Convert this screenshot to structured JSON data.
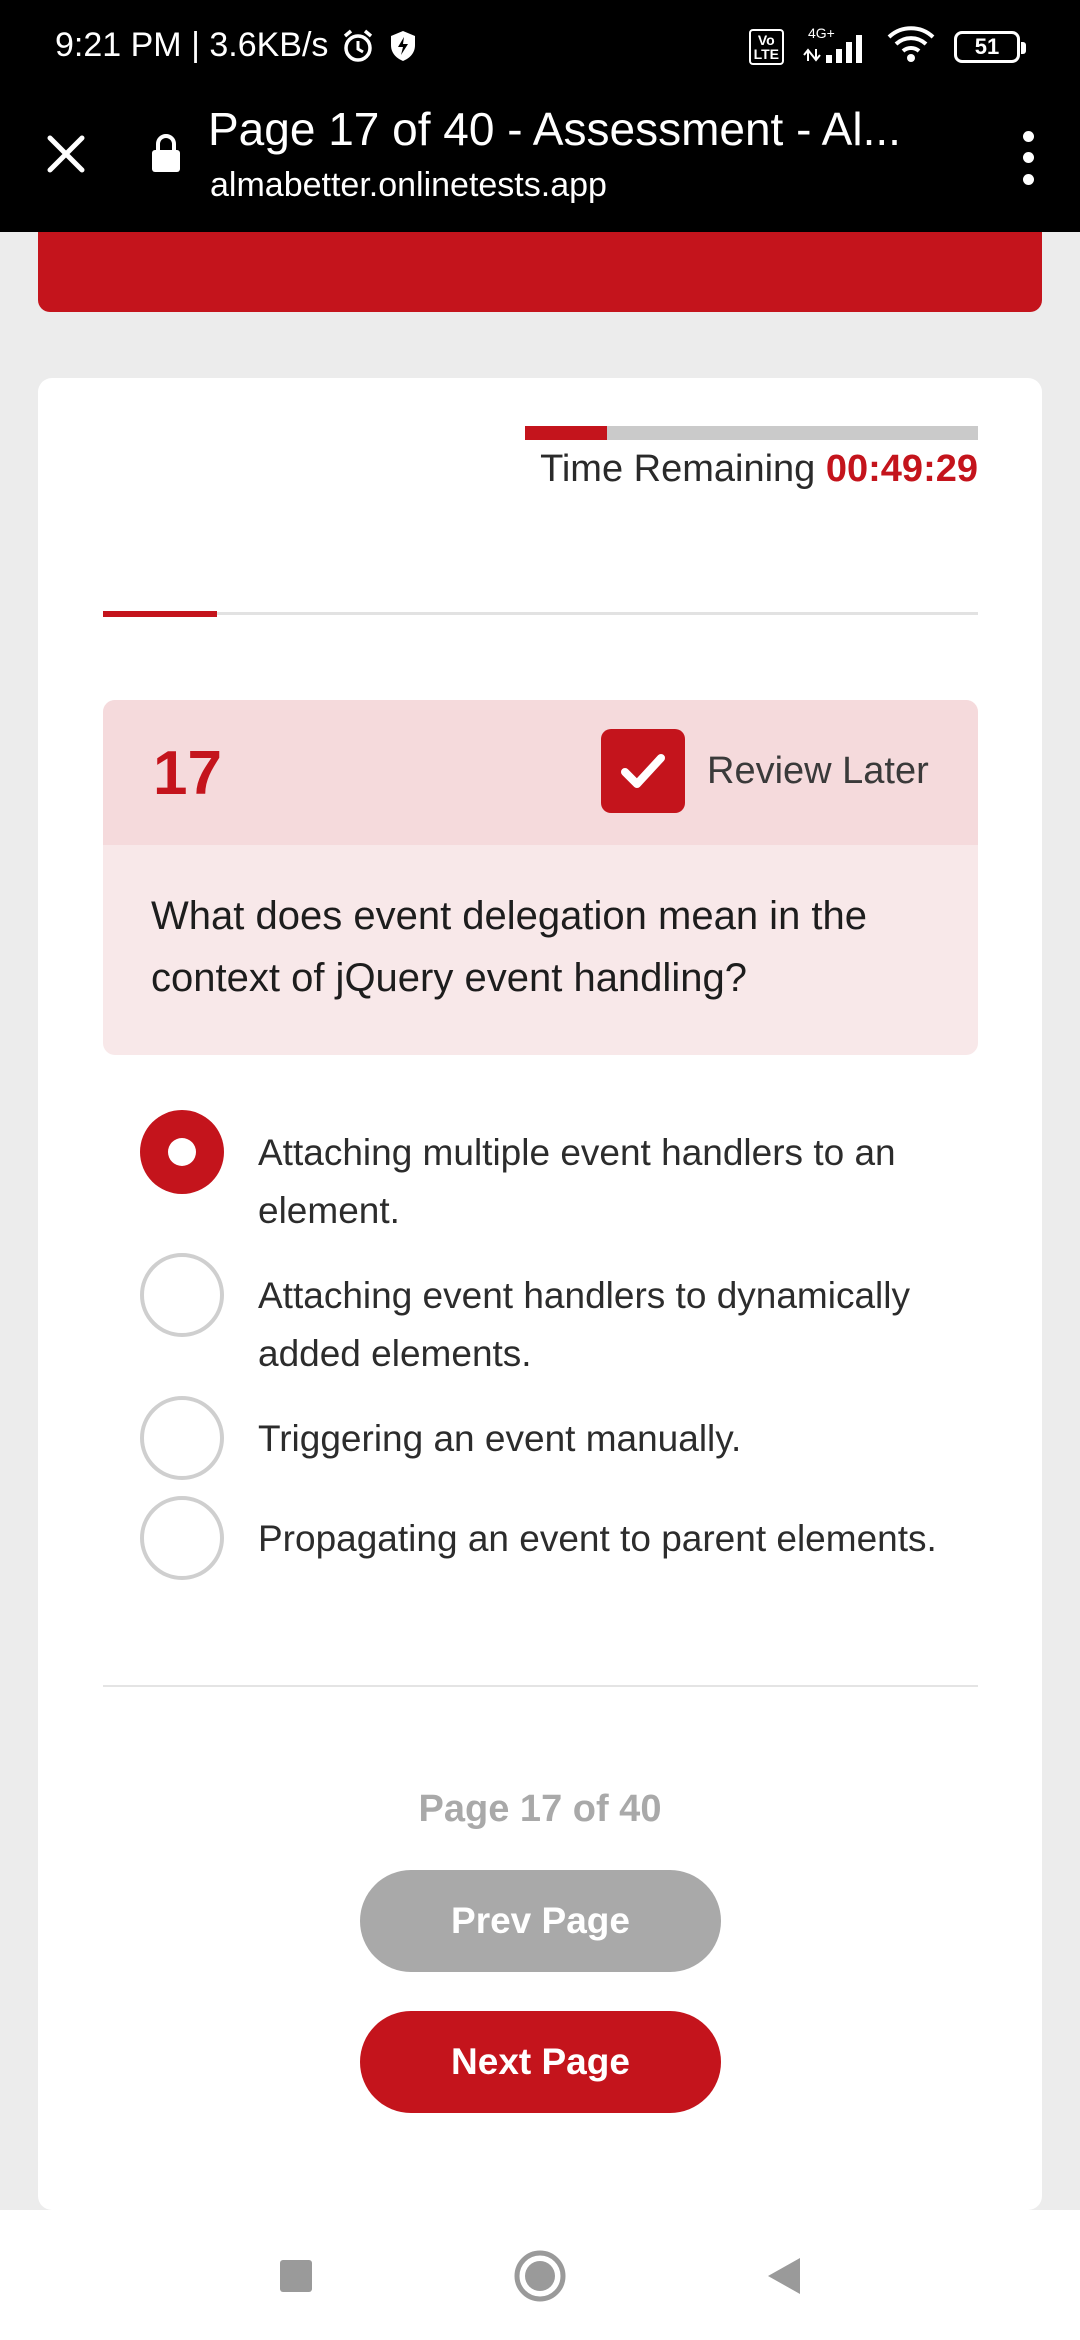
{
  "status_bar": {
    "time_speed": "9:21 PM | 3.6KB/s",
    "volte": "Vo\nLTE",
    "network_gen": "4G+",
    "battery": "51"
  },
  "browser": {
    "page_title": "Page 17 of 40 - Assessment - Al...",
    "domain": "almabetter.onlinetests.app"
  },
  "timer": {
    "label": "Time Remaining",
    "value": "00:49:29",
    "elapsed_fraction": 0.18
  },
  "progress": {
    "fraction": 0.13
  },
  "question": {
    "number": "17",
    "review_label": "Review Later",
    "review_checked": true,
    "text": "What does event delegation mean in the context of jQuery event handling?"
  },
  "options": [
    {
      "text": "Attaching multiple event handlers to an element.",
      "selected": true
    },
    {
      "text": "Attaching event handlers to dynamically added elements.",
      "selected": false
    },
    {
      "text": "Triggering an event manually.",
      "selected": false
    },
    {
      "text": "Propagating an event to parent elements.",
      "selected": false
    }
  ],
  "pagination": {
    "page_label": "Page 17 of 40",
    "prev_label": "Prev Page",
    "next_label": "Next Page"
  },
  "colors": {
    "accent": "#c4141c",
    "disabled": "#a9a9a9"
  },
  "icons": {
    "close": "close-icon",
    "lock": "lock-icon",
    "menu": "more-vertical-icon",
    "alarm": "alarm-icon",
    "shield": "shield-icon",
    "wifi": "wifi-icon",
    "signal": "signal-icon",
    "checkmark": "checkmark-icon",
    "nav_recents": "square-icon",
    "nav_home": "circle-icon",
    "nav_back": "triangle-back-icon"
  }
}
